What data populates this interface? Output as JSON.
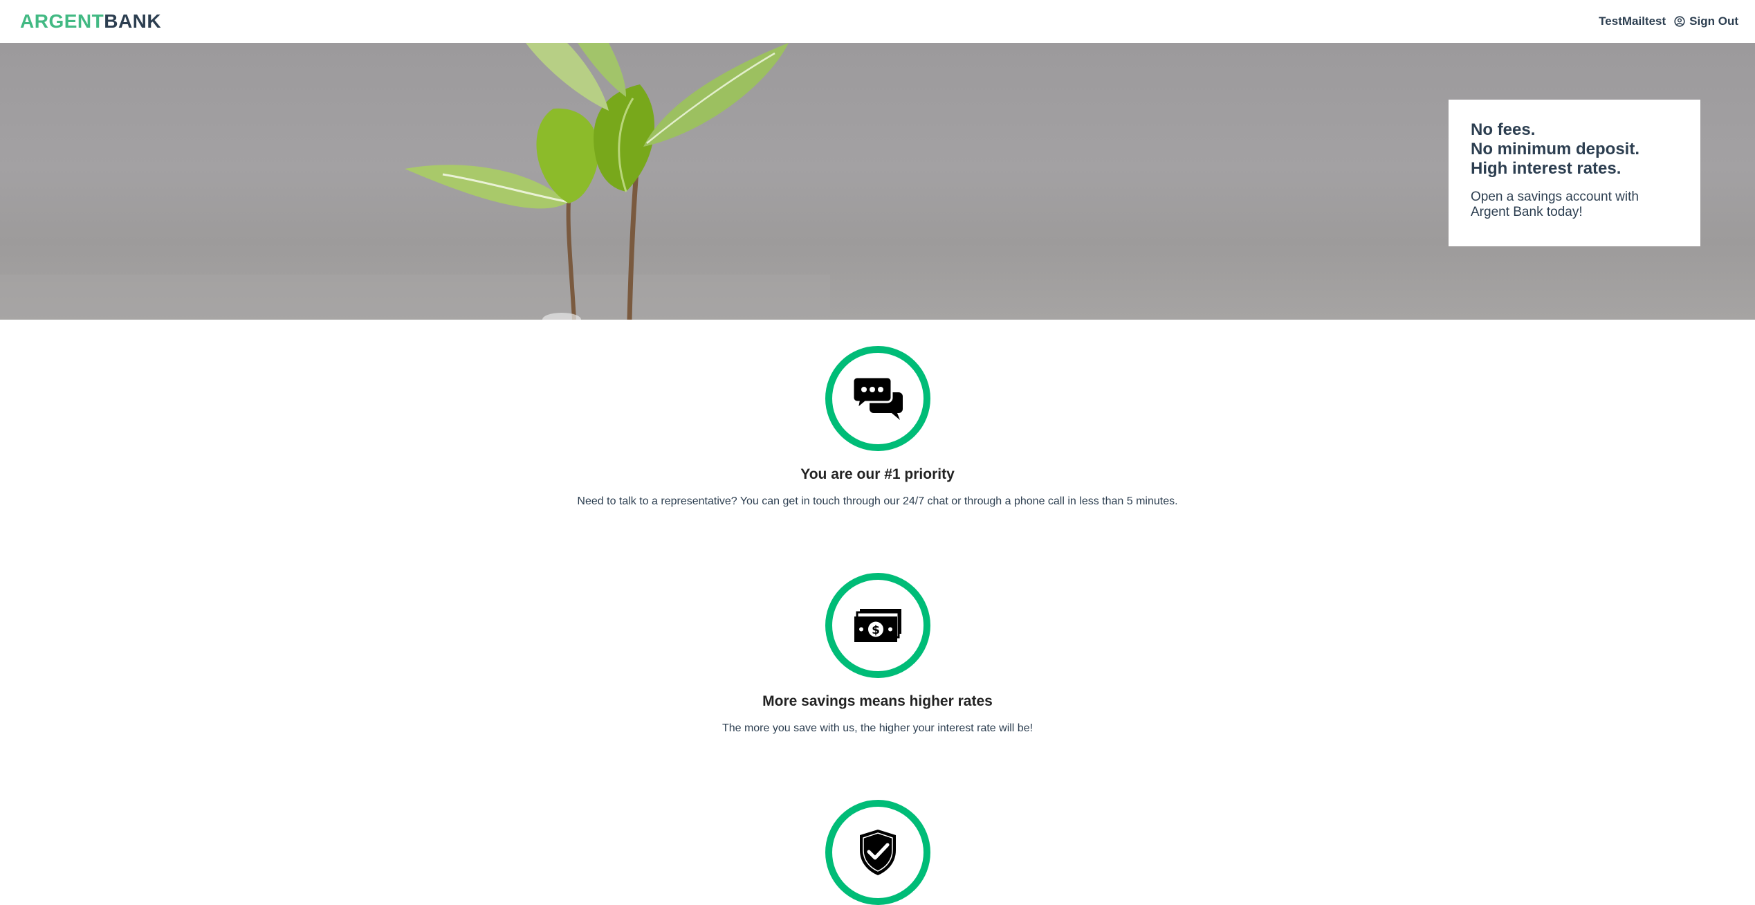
{
  "nav": {
    "logo_part1": "ARGENT",
    "logo_part2": "BANK",
    "username": "TestMailtest",
    "signout_label": "Sign Out"
  },
  "hero": {
    "subtitles": [
      "No fees.",
      "No minimum deposit.",
      "High interest rates."
    ],
    "text": "Open a savings account with Argent Bank today!"
  },
  "features": [
    {
      "icon": "chat-icon",
      "title": "You are our #1 priority",
      "text": "Need to talk to a representative? You can get in touch through our 24/7 chat or through a phone call in less than 5 minutes."
    },
    {
      "icon": "money-icon",
      "title": "More savings means higher rates",
      "text": "The more you save with us, the higher your interest rate will be!"
    },
    {
      "icon": "security-icon",
      "title": "",
      "text": ""
    }
  ],
  "colors": {
    "accent": "#00bc77",
    "logo_green": "#42b983",
    "text_dark": "#2c3e50"
  }
}
